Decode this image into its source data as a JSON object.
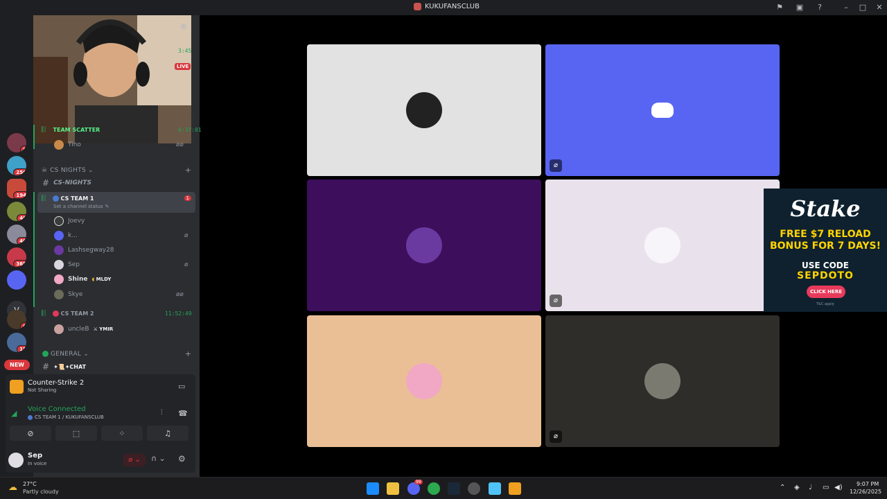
{
  "window": {
    "title": "KUKUFANSCLUB"
  },
  "sidebar_header": {
    "time_top": "3:45",
    "live_badge": "LIVE",
    "time_team_scatter": "6:37:01"
  },
  "channels": {
    "team_scatter": "TEAM SCATTER",
    "tino": "Tino",
    "cs_nights_category": "CS NIGHTS",
    "cs_nights_channel": "CS-NIGHTS",
    "cs_team_1": "CS TEAM 1",
    "cs_team_1_badge": "1",
    "cs_team_1_status": "Set a channel status",
    "members": [
      {
        "name": "Joevy",
        "color": "#3b3b3b"
      },
      {
        "name": "k...",
        "color": "#5865f2"
      },
      {
        "name": "Lashsegway28",
        "color": "#6a3aa0"
      },
      {
        "name": "Sep",
        "color": "#d9d5de"
      },
      {
        "name": "Shine",
        "color": "#f0a8c4"
      },
      {
        "name": "Skye",
        "color": "#6b6b5a"
      }
    ],
    "shine_tag": "MLDY",
    "cs_team_2": "CS TEAM 2",
    "cs_team_2_time": "11:52:49",
    "uncleb": "uncleB",
    "uncleb_tag": "YMIR",
    "general_category": "GENERAL",
    "chat_channel": "✦📜✦CHAT"
  },
  "servers": {
    "badges": [
      "8",
      "256",
      "194",
      "49",
      "40",
      "365",
      "6",
      "15"
    ],
    "letter_v": "V",
    "new_pill": "NEW"
  },
  "activity": {
    "game": "Counter-Strike 2",
    "game_status": "Not Sharing",
    "voice_status": "Voice Connected",
    "voice_channel": "CS TEAM 1 / KUKUFANSCLUB"
  },
  "user": {
    "name": "Sep",
    "status": "In voice"
  },
  "tiles": [
    {
      "bg": "#e2e2e2",
      "pic": "#222222",
      "muted": false,
      "icon": ""
    },
    {
      "bg": "#5865f2",
      "pic": "",
      "muted": true,
      "icon": "discord-logo"
    },
    {
      "bg": "#3c0e5c",
      "pic": "#6a3aa0",
      "muted": false,
      "icon": ""
    },
    {
      "bg": "#e9e2ec",
      "pic": "#f8f5fa",
      "muted": true,
      "icon": ""
    },
    {
      "bg": "#ebbf96",
      "pic": "#f0a8c4",
      "muted": false,
      "icon": ""
    },
    {
      "bg": "#2e2d29",
      "pic": "#7a7a70",
      "muted": true,
      "icon": ""
    }
  ],
  "ad": {
    "brand": "Stake",
    "promo_line1": "FREE $7 RELOAD",
    "promo_line2": "BONUS FOR 7 DAYS!",
    "use_code": "USE CODE",
    "code": "SEPDOTO",
    "cta": "CLICK HERE",
    "fine_print": "T&C apply"
  },
  "taskbar": {
    "weather_temp": "27°C",
    "weather_desc": "Partly cloudy",
    "discord_badge": "99",
    "time": "9:07 PM",
    "date": "12/26/2025"
  }
}
